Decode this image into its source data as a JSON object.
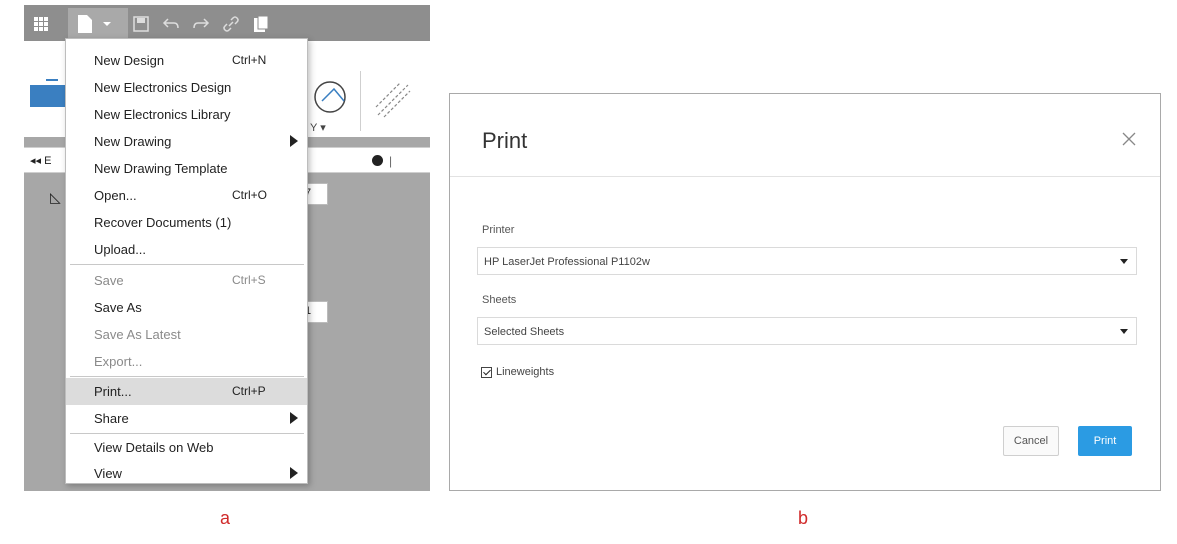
{
  "panel_a": {
    "caption": "a",
    "toolbar": {
      "icons": [
        "grid-icon",
        "new-file-icon",
        "save-icon",
        "undo-icon",
        "redo-icon",
        "link-icon",
        "clipboard-icon"
      ]
    },
    "ribbon": {
      "label": "Y ▾"
    },
    "browser": {
      "arrows": "◂◂ E",
      "bar": "|"
    },
    "side_values": [
      "7",
      "1"
    ],
    "file_menu": {
      "items": [
        {
          "label": "New Design",
          "shortcut": "Ctrl+N"
        },
        {
          "label": "New Electronics Design",
          "shortcut": ""
        },
        {
          "label": "New Electronics Library",
          "shortcut": ""
        },
        {
          "label": "New Drawing",
          "shortcut": ""
        },
        {
          "label": "New Drawing Template",
          "shortcut": ""
        },
        {
          "label": "Open...",
          "shortcut": "Ctrl+O"
        },
        {
          "label": "Recover Documents (1)",
          "shortcut": ""
        },
        {
          "label": "Upload...",
          "shortcut": ""
        },
        {
          "label": "Save",
          "shortcut": "Ctrl+S"
        },
        {
          "label": "Save As",
          "shortcut": ""
        },
        {
          "label": "Save As Latest",
          "shortcut": ""
        },
        {
          "label": "Export...",
          "shortcut": ""
        },
        {
          "label": "Print...",
          "shortcut": "Ctrl+P"
        },
        {
          "label": "Share",
          "shortcut": ""
        },
        {
          "label": "View Details on Web",
          "shortcut": ""
        },
        {
          "label": "View",
          "shortcut": ""
        }
      ]
    }
  },
  "panel_b": {
    "caption": "b",
    "dialog": {
      "title": "Print",
      "printer_label": "Printer",
      "printer_value": "HP LaserJet Professional P1102w",
      "sheets_label": "Sheets",
      "sheets_value": "Selected Sheets",
      "lineweights_label": "Lineweights",
      "lineweights_checked": true,
      "cancel_label": "Cancel",
      "print_label": "Print"
    }
  },
  "colors": {
    "primary_button": "#2b9be3",
    "caption": "#d02a2a",
    "menu_highlight": "#dcdcdc"
  }
}
